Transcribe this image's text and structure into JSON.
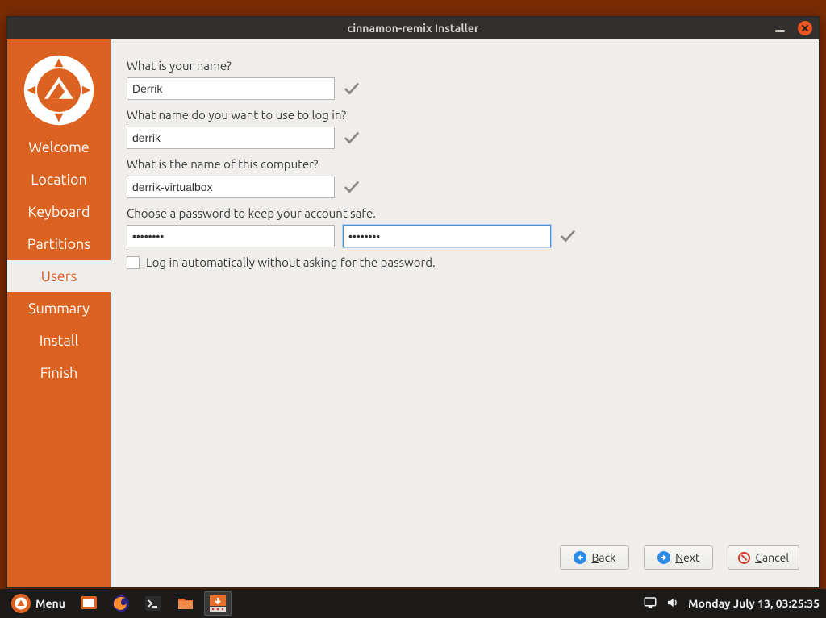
{
  "window": {
    "title": "cinnamon-remix Installer"
  },
  "sidebar": {
    "items": [
      {
        "label": "Welcome",
        "active": false
      },
      {
        "label": "Location",
        "active": false
      },
      {
        "label": "Keyboard",
        "active": false
      },
      {
        "label": "Partitions",
        "active": false
      },
      {
        "label": "Users",
        "active": true
      },
      {
        "label": "Summary",
        "active": false
      },
      {
        "label": "Install",
        "active": false
      },
      {
        "label": "Finish",
        "active": false
      }
    ]
  },
  "form": {
    "name_label": "What is your name?",
    "name_value": "Derrik",
    "login_label": "What name do you want to use to log in?",
    "login_value": "derrik",
    "host_label": "What is the name of this computer?",
    "host_value": "derrik-virtualbox",
    "password_label": "Choose a password to keep your account safe.",
    "password1": "••••••••",
    "password2": "••••••••",
    "autologin_label": "Log in automatically without asking for the password.",
    "autologin_checked": false
  },
  "footer": {
    "back": "Back",
    "next": "Next",
    "cancel": "Cancel"
  },
  "taskbar": {
    "menu_label": "Menu",
    "clock": "Monday July 13, 03:25:35"
  }
}
